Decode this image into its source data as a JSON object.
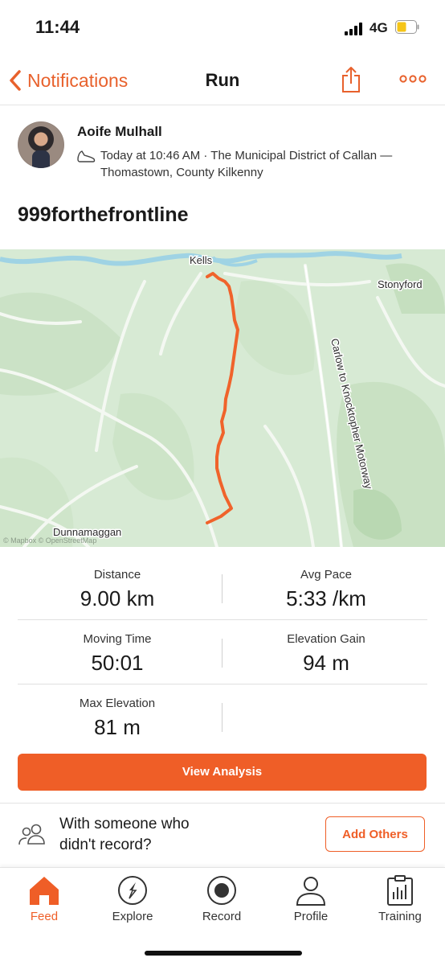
{
  "status_bar": {
    "time": "11:44",
    "network": "4G"
  },
  "nav": {
    "back_label": "Notifications",
    "title": "Run"
  },
  "activity": {
    "athlete_name": "Aoife Mulhall",
    "meta_line1": "Today at 10:46 AM · The Municipal District of Callan —",
    "meta_line2": "Thomastown, County Kilkenny",
    "title": "999forthefrontline"
  },
  "map": {
    "labels": {
      "kells": "Kells",
      "stonyford": "Stonyford",
      "motorway": "Carlow to Knocktopher Motorway",
      "dunnamaggan": "Dunnamaggan",
      "attribution": "© Mapbox © OpenStreetMap"
    },
    "route_color": "#f0632b"
  },
  "stats": [
    {
      "label": "Distance",
      "value": "9.00 km"
    },
    {
      "label": "Avg Pace",
      "value": "5:33 /km"
    },
    {
      "label": "Moving Time",
      "value": "50:01"
    },
    {
      "label": "Elevation Gain",
      "value": "94 m"
    },
    {
      "label": "Max Elevation",
      "value": "81 m"
    }
  ],
  "actions": {
    "view_analysis": "View Analysis",
    "with_someone_line1": "With someone who",
    "with_someone_line2": "didn't record?",
    "add_others": "Add Others"
  },
  "tabs": [
    {
      "label": "Feed",
      "icon": "home-icon",
      "active": true
    },
    {
      "label": "Explore",
      "icon": "compass-icon",
      "active": false
    },
    {
      "label": "Record",
      "icon": "record-icon",
      "active": false
    },
    {
      "label": "Profile",
      "icon": "person-icon",
      "active": false
    },
    {
      "label": "Training",
      "icon": "chart-clipboard-icon",
      "active": false
    }
  ],
  "colors": {
    "accent": "#ef5e27",
    "map_bg": "#d7ead4"
  }
}
